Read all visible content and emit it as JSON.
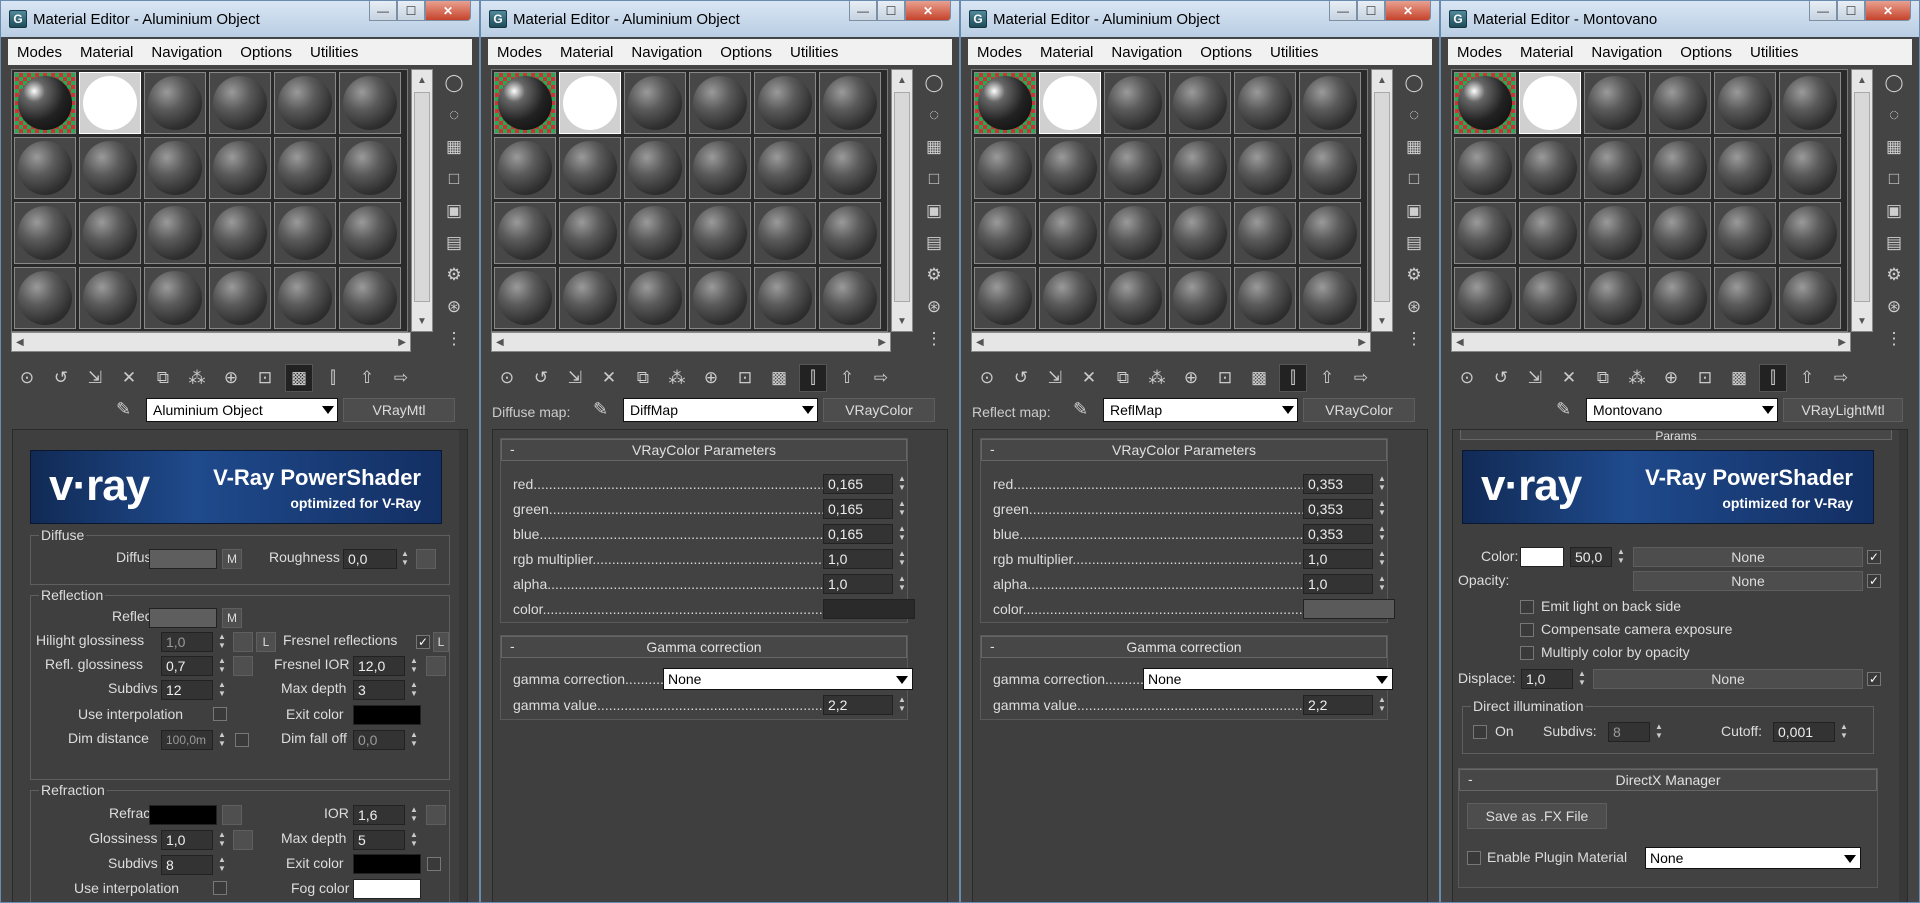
{
  "windows": [
    {
      "title": "Material Editor - Aluminium Object",
      "menu": [
        "Modes",
        "Material",
        "Navigation",
        "Options",
        "Utilities"
      ],
      "material_name": "Aluminium Object",
      "material_type": "VRayMtl",
      "banner": {
        "logo": "v·ray",
        "title": "V-Ray PowerShader",
        "subtitle": "optimized for V-Ray"
      },
      "diffuse": {
        "title": "Diffuse",
        "diffuse_label": "Diffuse",
        "m": "M",
        "roughness_label": "Roughness",
        "roughness": "0,0"
      },
      "reflection": {
        "title": "Reflection",
        "reflect_label": "Reflect",
        "m": "M",
        "hilight_label": "Hilight glossiness",
        "hilight": "1,0",
        "l": "L",
        "fresnel_label": "Fresnel reflections",
        "fresnel_check": "✓",
        "fresnel_l": "L",
        "refl_gloss_label": "Refl. glossiness",
        "refl_gloss": "0,7",
        "fresnel_ior_label": "Fresnel IOR",
        "fresnel_ior": "12,0",
        "subdivs_label": "Subdivs",
        "subdivs": "12",
        "maxdepth_label": "Max depth",
        "maxdepth": "3",
        "use_interp_label": "Use interpolation",
        "exit_label": "Exit color",
        "dim_dist_label": "Dim distance",
        "dim_dist": "100,0m",
        "dim_fall_label": "Dim fall off",
        "dim_fall": "0,0"
      },
      "refraction": {
        "title": "Refraction",
        "refract_label": "Refract",
        "ior_label": "IOR",
        "ior": "1,6",
        "gloss_label": "Glossiness",
        "gloss": "1,0",
        "maxdepth_label": "Max depth",
        "maxdepth": "5",
        "subdivs_label": "Subdivs",
        "subdivs": "8",
        "exit_label": "Exit color",
        "use_interp_label": "Use interpolation",
        "fog_label": "Fog color"
      }
    },
    {
      "title": "Material Editor - Aluminium Object",
      "menu": [
        "Modes",
        "Material",
        "Navigation",
        "Options",
        "Utilities"
      ],
      "map_label": "Diffuse map:",
      "material_name": "DiffMap",
      "material_type": "VRayColor",
      "params_title": "VRayColor Parameters",
      "params": [
        {
          "label": "red",
          "value": "0,165"
        },
        {
          "label": "green",
          "value": "0,165"
        },
        {
          "label": "blue",
          "value": "0,165"
        },
        {
          "label": "rgb multiplier",
          "value": "1,0"
        },
        {
          "label": "alpha",
          "value": "1,0"
        }
      ],
      "color_label": "color",
      "color_hex": "#2a2a2a",
      "gamma_title": "Gamma correction",
      "gamma_corr_label": "gamma correction",
      "gamma_corr_value": "None",
      "gamma_value_label": "gamma value",
      "gamma_value": "2,2"
    },
    {
      "title": "Material Editor - Aluminium Object",
      "menu": [
        "Modes",
        "Material",
        "Navigation",
        "Options",
        "Utilities"
      ],
      "map_label": "Reflect map:",
      "material_name": "ReflMap",
      "material_type": "VRayColor",
      "params_title": "VRayColor Parameters",
      "params": [
        {
          "label": "red",
          "value": "0,353"
        },
        {
          "label": "green",
          "value": "0,353"
        },
        {
          "label": "blue",
          "value": "0,353"
        },
        {
          "label": "rgb multiplier",
          "value": "1,0"
        },
        {
          "label": "alpha",
          "value": "1,0"
        }
      ],
      "color_label": "color",
      "color_hex": "#5a5a5a",
      "gamma_title": "Gamma correction",
      "gamma_corr_label": "gamma correction",
      "gamma_corr_value": "None",
      "gamma_value_label": "gamma value",
      "gamma_value": "2,2"
    },
    {
      "title": "Material Editor - Montovano",
      "menu": [
        "Modes",
        "Material",
        "Navigation",
        "Options",
        "Utilities"
      ],
      "material_name": "Montovano",
      "material_type": "VRayLightMtl",
      "params_stub": "Params",
      "banner": {
        "logo": "v·ray",
        "title": "V-Ray PowerShader",
        "subtitle": "optimized for V-Ray"
      },
      "color_label": "Color:",
      "color_mult": "50,0",
      "none": "None",
      "opacity_label": "Opacity:",
      "emit_back_label": "Emit light on back side",
      "comp_cam_label": "Compensate camera exposure",
      "mult_opacity_label": "Multiply color by opacity",
      "displace_label": "Displace:",
      "displace": "1,0",
      "direct_title": "Direct illumination",
      "on_label": "On",
      "subdivs_label": "Subdivs:",
      "subdivs": "8",
      "cutoff_label": "Cutoff:",
      "cutoff": "0,001",
      "dx_title": "DirectX Manager",
      "save_fx_label": "Save as .FX File",
      "enable_plugin_label": "Enable Plugin Material",
      "plugin_value": "None",
      "check": "✓"
    }
  ],
  "window_controls": {
    "minimize": "—",
    "maximize": "☐",
    "close": "✕"
  },
  "app_icon": "G"
}
